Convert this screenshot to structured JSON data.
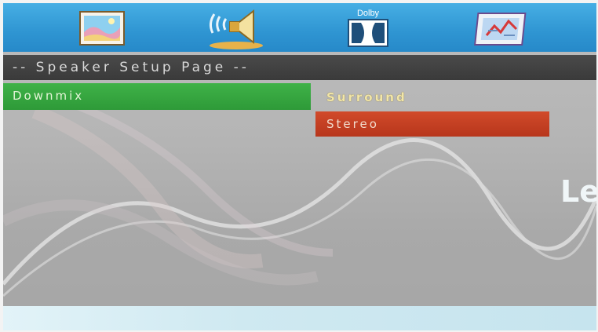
{
  "tabs": [
    {
      "name": "picture-setup",
      "icon": "picture-icon"
    },
    {
      "name": "speaker-setup",
      "icon": "speaker-icon"
    },
    {
      "name": "dolby-setup",
      "icon": "dolby-icon",
      "text": "Dolby"
    },
    {
      "name": "preference-setup",
      "icon": "preference-icon"
    }
  ],
  "page_title": "-- Speaker Setup Page --",
  "menu": {
    "item_label": "Downmix"
  },
  "options": [
    {
      "label": "Surround"
    },
    {
      "label": "Stereo",
      "state": "highlighted"
    }
  ],
  "background_logo": "Le",
  "colors": {
    "top_bar": "#2f95d2",
    "page_bar": "#404040",
    "selected_item": "#35a63f",
    "highlight_option": "#c23f22"
  }
}
